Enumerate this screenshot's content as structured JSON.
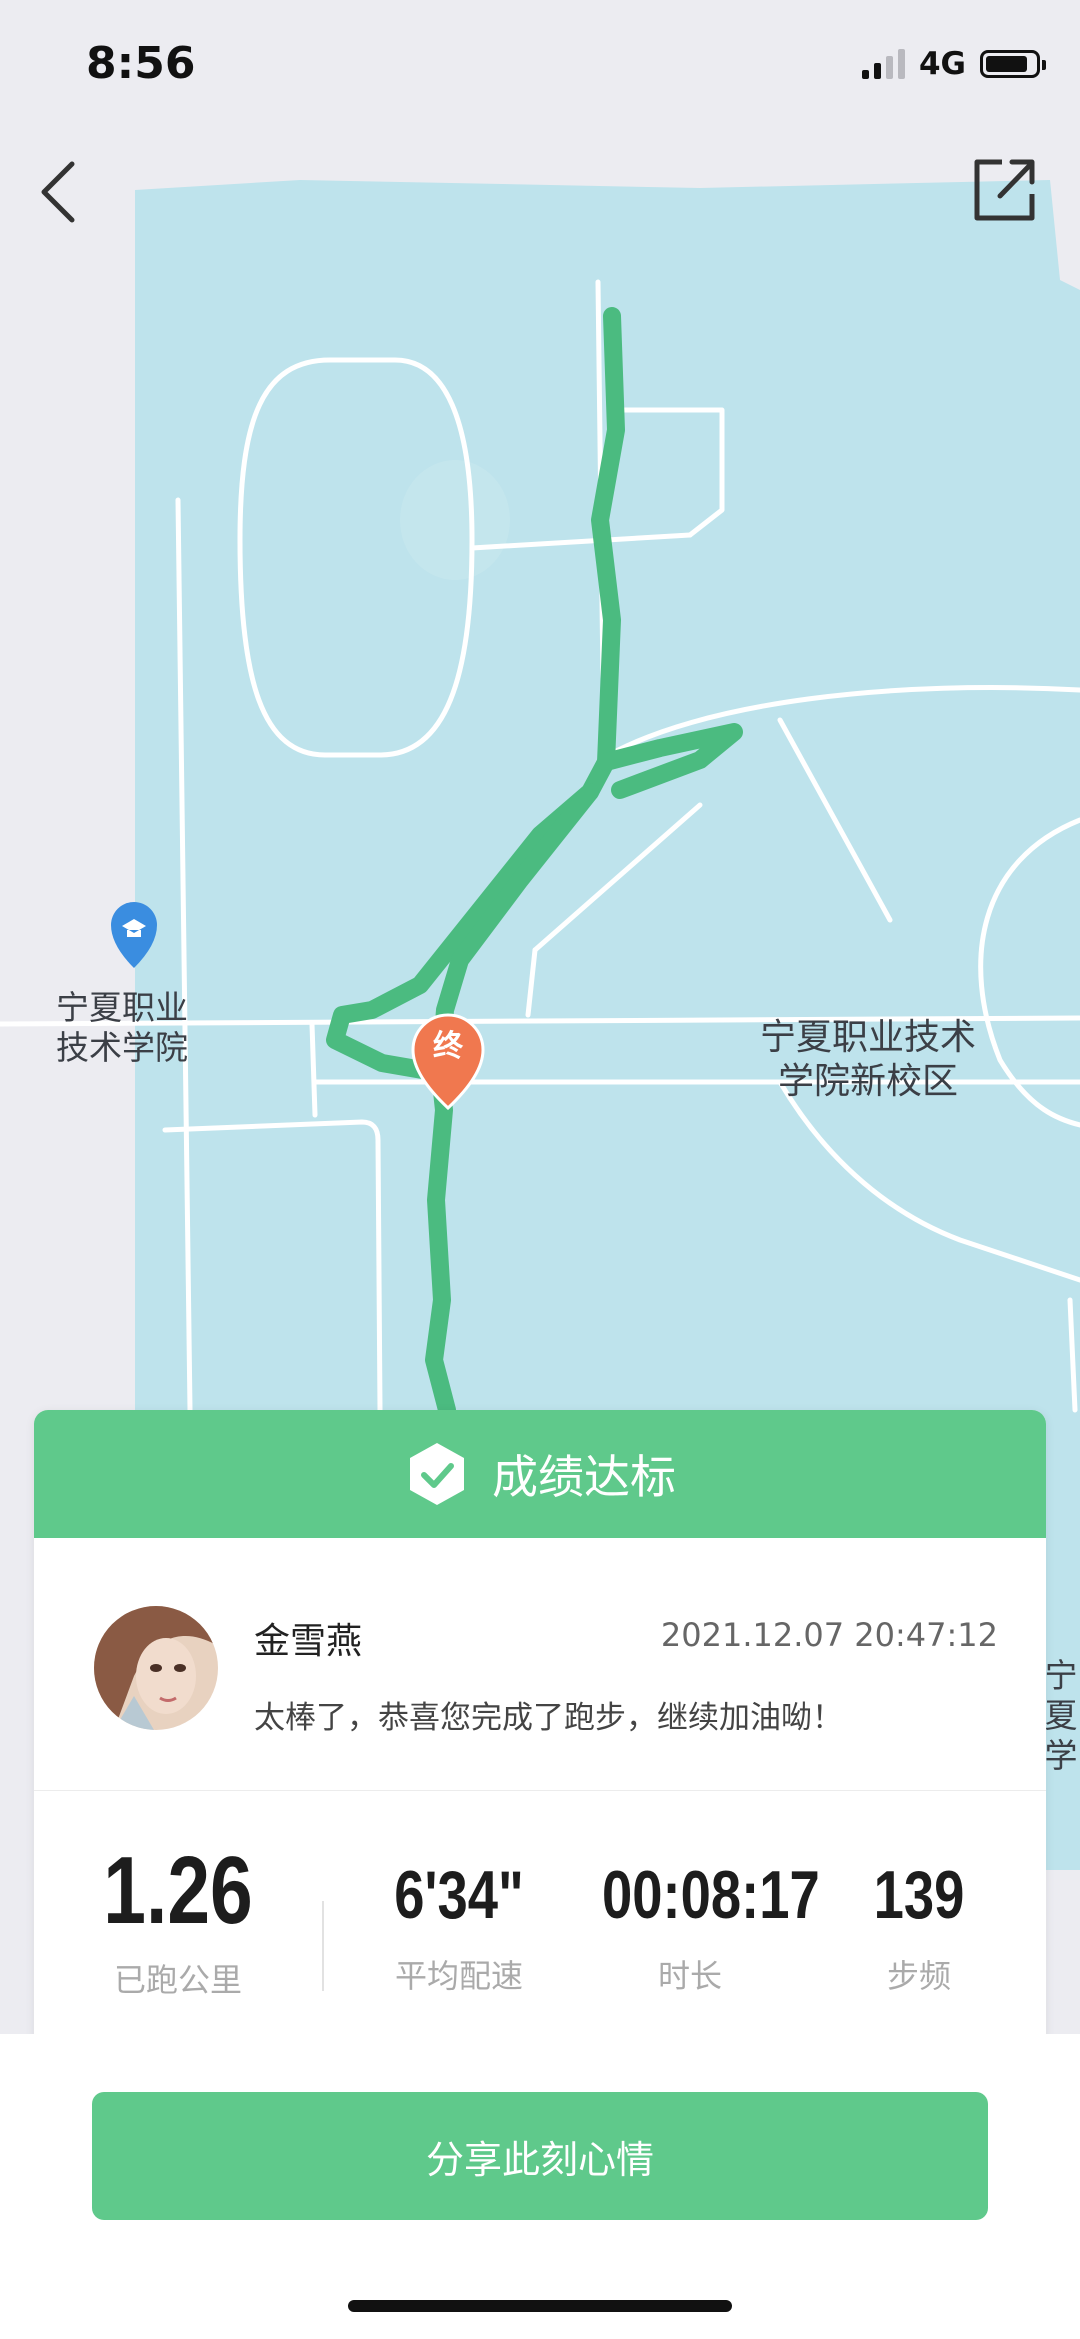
{
  "status_bar": {
    "time": "8:56",
    "network": "4G",
    "signal_bars": 2,
    "battery_level": 0.85
  },
  "map": {
    "label_school": [
      "宁夏职业",
      "技术学院"
    ],
    "label_campus": [
      "宁夏职业技术",
      "学院新校区"
    ],
    "label_edge": [
      "宁夏",
      "学"
    ],
    "end_marker": "终",
    "colors": {
      "water": "#bee3ec",
      "route": "#4bbb80",
      "marker": "#f0784f"
    }
  },
  "result": {
    "status": "成绩达标",
    "user_name": "金雪燕",
    "datetime": "2021.12.07 20:47:12",
    "message": "太棒了，恭喜您完成了跑步，继续加油呦！"
  },
  "stats": [
    {
      "value": "1.26",
      "label": "已跑公里"
    },
    {
      "value": "6'34\"",
      "label": "平均配速"
    },
    {
      "value": "00:08:17",
      "label": "时长"
    },
    {
      "value": "139",
      "label": "步频"
    }
  ],
  "actions": {
    "share_label": "分享此刻心情"
  },
  "colors": {
    "accent": "#5fc98b"
  }
}
